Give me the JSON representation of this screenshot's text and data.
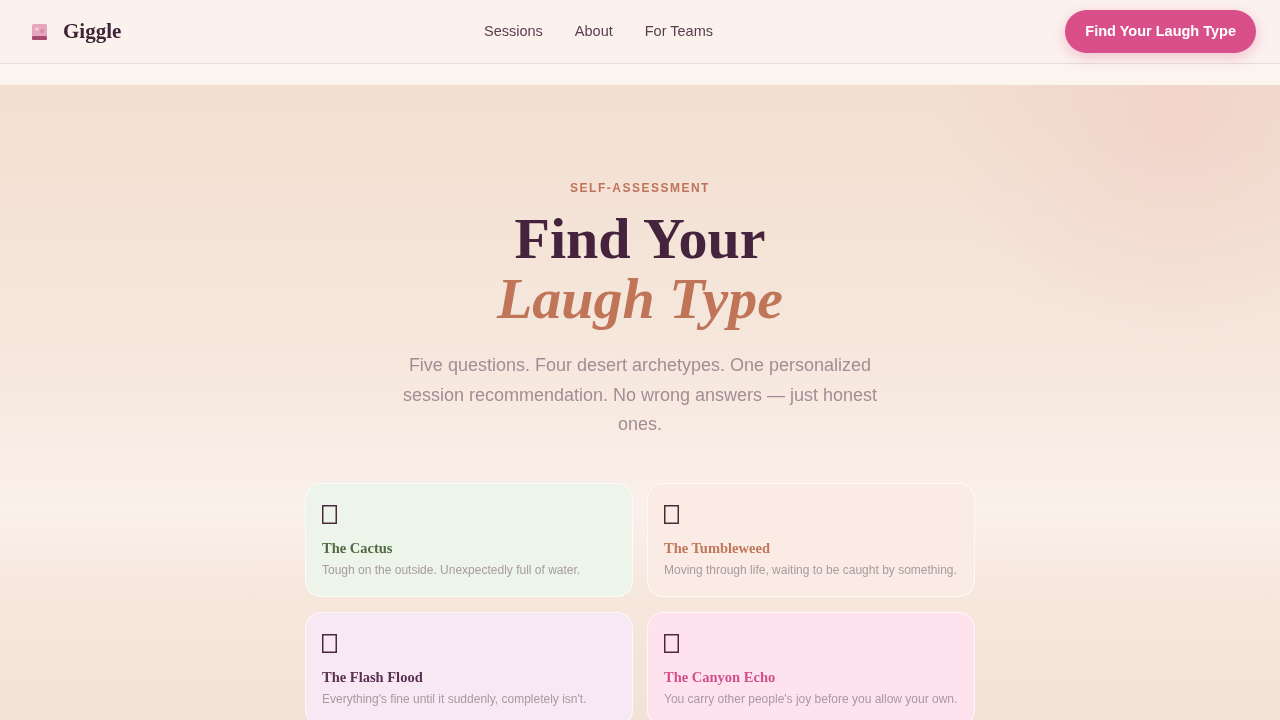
{
  "navbar": {
    "brand": "Giggle",
    "links": [
      "Sessions",
      "About",
      "For Teams"
    ],
    "cta": "Find Your Laugh Type"
  },
  "hero": {
    "eyebrow": "SELF-ASSESSMENT",
    "title": "Find Your",
    "title_accent": "Laugh Type",
    "lead": "Five questions. Four desert archetypes. One personalized session recommendation. No wrong answers — just honest ones."
  },
  "types": [
    {
      "name": "The Cactus",
      "description": "Tough on the outside. Unexpectedly full of water.",
      "color": "#4f6b43"
    },
    {
      "name": "The Tumbleweed",
      "description": "Moving through life, waiting to be caught by something.",
      "color": "#c0785a"
    },
    {
      "name": "The Flash Flood",
      "description": "Everything's fine until it suddenly, completely isn't.",
      "color": "#5a3050"
    },
    {
      "name": "The Canyon Echo",
      "description": "You carry other people's joy before you allow your own.",
      "color": "#d0508a"
    }
  ]
}
